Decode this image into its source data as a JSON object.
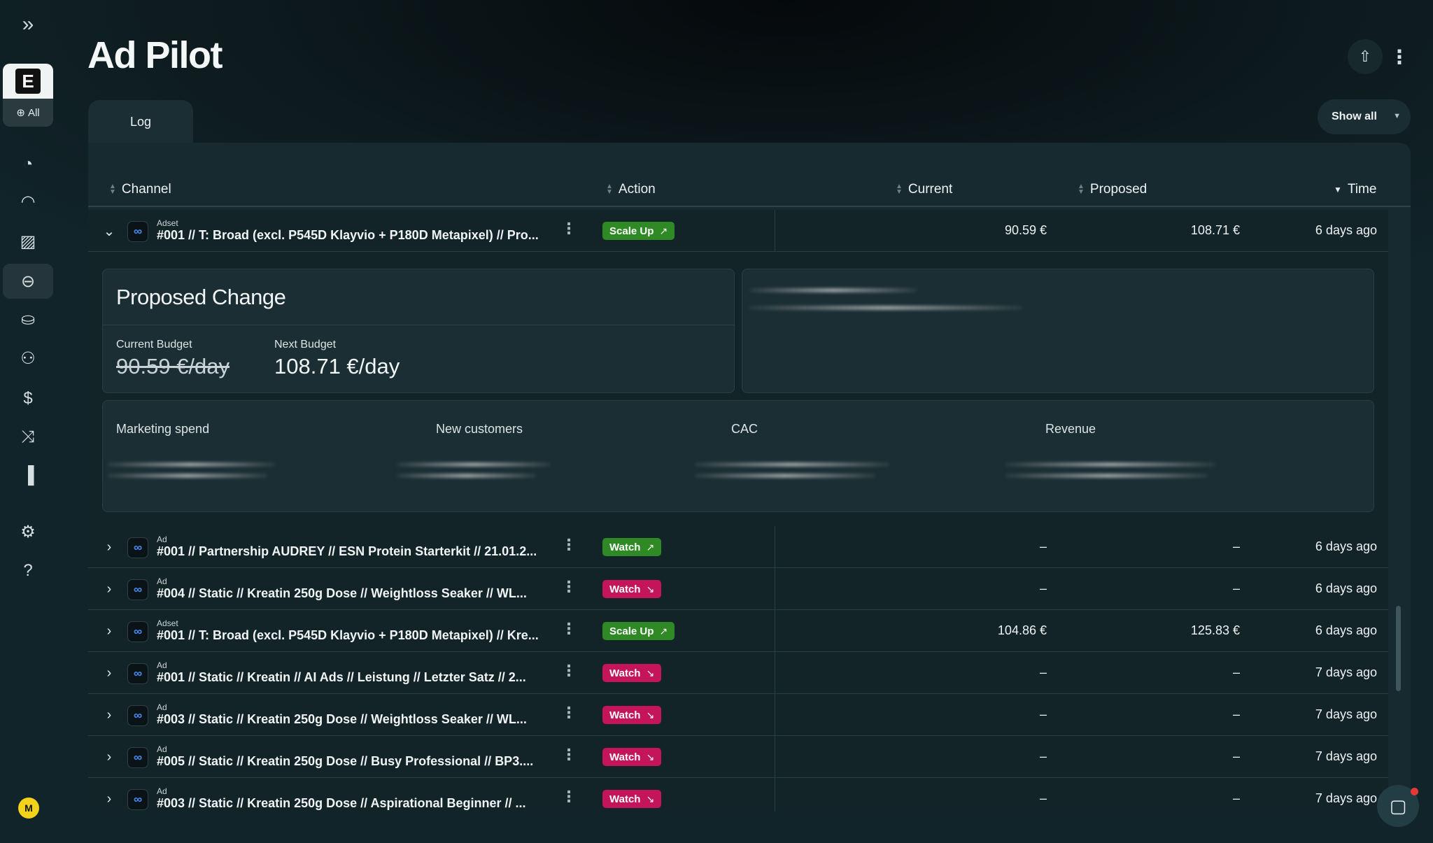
{
  "sidebar": {
    "expand_icon": "double-chevron-right-icon",
    "workspace": {
      "logo_letter": "E",
      "filter_label": "All"
    },
    "items": [
      {
        "id": "dashboard",
        "icon": "pie-chart-icon"
      },
      {
        "id": "performance",
        "icon": "gauge-icon"
      },
      {
        "id": "creatives",
        "icon": "image-icon"
      },
      {
        "id": "ad-pilot",
        "icon": "pilot-icon",
        "active": true
      },
      {
        "id": "products",
        "icon": "basket-icon"
      },
      {
        "id": "customers",
        "icon": "users-icon"
      },
      {
        "id": "finance",
        "icon": "coin-icon"
      },
      {
        "id": "attribution",
        "icon": "shuffle-icon"
      },
      {
        "id": "reports",
        "icon": "bar-chart-icon"
      },
      {
        "id": "settings",
        "icon": "gear-icon"
      },
      {
        "id": "help",
        "icon": "help-icon"
      }
    ],
    "avatar_initial": "M"
  },
  "header": {
    "title": "Ad Pilot"
  },
  "tabs": [
    {
      "label": "Log",
      "active": true
    }
  ],
  "filter": {
    "label": "Show all"
  },
  "table": {
    "columns": {
      "channel": "Channel",
      "action": "Action",
      "current": "Current",
      "proposed": "Proposed",
      "time": "Time"
    },
    "expanded_row": {
      "kind": "Adset",
      "name": "#001 // T: Broad (excl. P545D Klayvio + P180D Metapixel) // Pro...",
      "action": "Scale Up",
      "current": "90.59 €",
      "proposed": "108.71 €",
      "time": "6 days ago"
    },
    "detail": {
      "title": "Proposed Change",
      "current_budget_label": "Current Budget",
      "current_budget": "90.59 €/day",
      "next_budget_label": "Next Budget",
      "next_budget": "108.71 €/day",
      "metrics": [
        "Marketing spend",
        "New customers",
        "CAC",
        "Revenue"
      ]
    },
    "rows": [
      {
        "kind": "Ad",
        "name": "#001 // Partnership AUDREY // ESN Protein Starterkit // 21.01.2...",
        "action": "Watch",
        "trend": "up",
        "current": "–",
        "proposed": "–",
        "time": "6 days ago"
      },
      {
        "kind": "Ad",
        "name": "#004 // Static // Kreatin 250g Dose // Weightloss Seaker // WL...",
        "action": "Watch",
        "trend": "down",
        "current": "–",
        "proposed": "–",
        "time": "6 days ago"
      },
      {
        "kind": "Adset",
        "name": "#001 // T: Broad (excl. P545D Klayvio + P180D Metapixel) // Kre...",
        "action": "Scale Up",
        "trend": "up",
        "current": "104.86 €",
        "proposed": "125.83 €",
        "time": "6 days ago"
      },
      {
        "kind": "Ad",
        "name": "#001 // Static // Kreatin // AI Ads // Leistung // Letzter Satz // 2...",
        "action": "Watch",
        "trend": "down",
        "current": "–",
        "proposed": "–",
        "time": "7 days ago"
      },
      {
        "kind": "Ad",
        "name": "#003 // Static // Kreatin 250g Dose // Weightloss Seaker // WL...",
        "action": "Watch",
        "trend": "down",
        "current": "–",
        "proposed": "–",
        "time": "7 days ago"
      },
      {
        "kind": "Ad",
        "name": "#005 // Static // Kreatin 250g Dose // Busy Professional // BP3....",
        "action": "Watch",
        "trend": "down",
        "current": "–",
        "proposed": "–",
        "time": "7 days ago"
      },
      {
        "kind": "Ad",
        "name": "#003 // Static // Kreatin 250g Dose // Aspirational Beginner // ...",
        "action": "Watch",
        "trend": "down",
        "current": "–",
        "proposed": "–",
        "time": "7 days ago"
      }
    ]
  },
  "colors": {
    "scale_up": "#2f8a26",
    "watch_down": "#c4155b",
    "watch_up": "#2f8a26",
    "meta_blue": "#4a8cf7"
  }
}
